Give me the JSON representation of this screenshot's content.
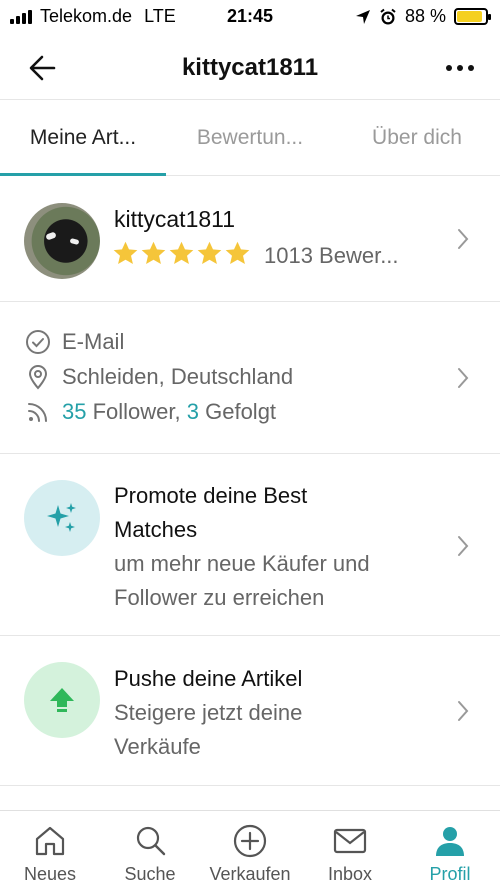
{
  "status_bar": {
    "carrier": "Telekom.de",
    "network": "LTE",
    "time": "21:45",
    "battery": "88 %",
    "battery_level": 0.88,
    "battery_color": "#f5d020"
  },
  "navbar": {
    "title": "kittycat1811",
    "back_icon": "arrow-left-icon",
    "more_icon": "more-horizontal-icon"
  },
  "tabs": [
    {
      "label": "Meine Art...",
      "active": true
    },
    {
      "label": "Bewertun...",
      "active": false
    },
    {
      "label": "Über dich",
      "active": false
    }
  ],
  "profile": {
    "username": "kittycat1811",
    "rating_stars": 5,
    "rating_count": "1013 Bewer...",
    "star_color": "#f5c53a"
  },
  "info": {
    "email": "E-Mail",
    "location": "Schleiden, Deutschland",
    "followers_count": "35",
    "followers_label": " Follower, ",
    "following_count": "3",
    "following_label": " Gefolgt"
  },
  "promote": {
    "title_line1": "Promote deine Best",
    "title_line2": "Matches",
    "subtitle_line1": "um mehr neue Käufer und",
    "subtitle_line2": "Follower zu erreichen",
    "icon": "sparkles-icon",
    "bg_color": "#d6eef1"
  },
  "push": {
    "title": "Pushe deine Artikel",
    "subtitle_line1": "Steigere jetzt deine",
    "subtitle_line2": "Verkäufe",
    "icon": "arrow-up-icon",
    "bg_color": "#d4f2dc"
  },
  "tabbar": {
    "items": [
      {
        "label": "Neues",
        "icon": "home-icon"
      },
      {
        "label": "Suche",
        "icon": "search-icon"
      },
      {
        "label": "Verkaufen",
        "icon": "plus-circle-icon"
      },
      {
        "label": "Inbox",
        "icon": "mail-icon"
      },
      {
        "label": "Profil",
        "icon": "profile-icon",
        "active": true
      }
    ]
  },
  "colors": {
    "accent": "#25a0a8",
    "muted_text": "#666666"
  }
}
